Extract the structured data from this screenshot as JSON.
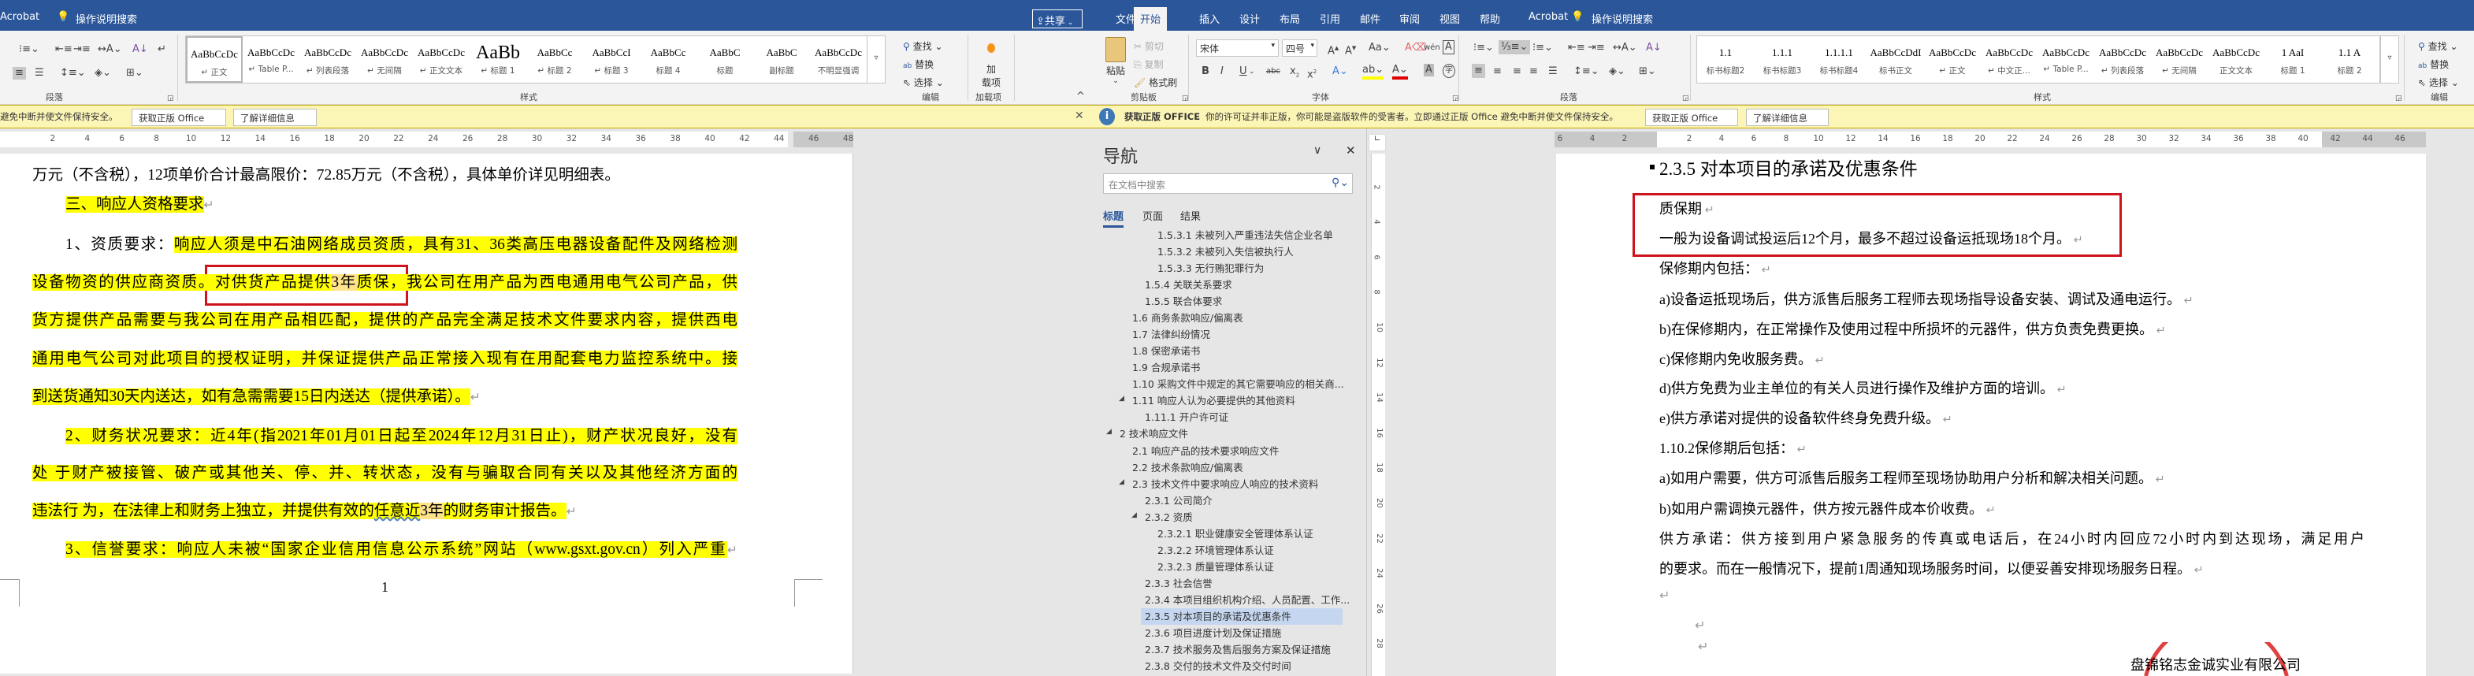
{
  "left_window": {
    "titlebar": {
      "acrobat_tab": "Acrobat",
      "search": "操作说明搜索",
      "share": "共享"
    },
    "ribbon": {
      "paragraph_label": "段落",
      "styles_label": "样式",
      "styles": [
        {
          "preview": "AaBbCcDc",
          "label": "↵ 正文",
          "selected": true
        },
        {
          "preview": "AaBbCcDc",
          "label": "↵ Table P..."
        },
        {
          "preview": "AaBbCcDc",
          "label": "↵ 列表段落"
        },
        {
          "preview": "AaBbCcDc",
          "label": "↵ 无间隔"
        },
        {
          "preview": "AaBbCcDc",
          "label": "↵ 正文文本"
        },
        {
          "preview": "AaBb",
          "label": "↵ 标题 1"
        },
        {
          "preview": "AaBbCc",
          "label": "↵ 标题 2"
        },
        {
          "preview": "AaBbCcI",
          "label": "↵ 标题 3"
        },
        {
          "preview": "AaBbCc",
          "label": "标题 4"
        },
        {
          "preview": "AaBbC",
          "label": "标题"
        },
        {
          "preview": "AaBbC",
          "label": "副标题"
        },
        {
          "preview": "AaBbCcDc",
          "label": "不明显强调"
        }
      ],
      "edit": {
        "find": "查找",
        "replace": "替换",
        "select": "选择",
        "label": "编辑"
      },
      "addins": {
        "button_line1": "加",
        "button_line2": "载项",
        "label": "加载项"
      }
    },
    "infobar": {
      "text": "避免中断并使文件保持安全。",
      "get_office": "获取正版 Office",
      "learn_more": "了解详细信息"
    },
    "ruler": [
      "2",
      "4",
      "6",
      "8",
      "10",
      "12",
      "14",
      "16",
      "18",
      "20",
      "22",
      "24",
      "26",
      "28",
      "30",
      "32",
      "34",
      "36",
      "38",
      "40",
      "42",
      "44",
      "46",
      "48"
    ],
    "document": {
      "page_number": "1",
      "lines": [
        {
          "indent": false,
          "segments": [
            {
              "text": "万元（不含税），12项单价合计最高限价：72.85万元（不含税），具体单价详见明细表。",
              "hl": ""
            }
          ]
        },
        {
          "indent": true,
          "segments": [
            {
              "text": "三、响应人资格要求",
              "hl": "hl"
            },
            {
              "text": "↵",
              "hl": "pm"
            }
          ]
        },
        {
          "indent": true,
          "justify": true,
          "segments": [
            {
              "text": "1、资质要求：",
              "hl": ""
            },
            {
              "text": "响应人须是中石油网络成员资质，具有31、36类高压电器设备配件及网络检测",
              "hl": "hl"
            }
          ]
        },
        {
          "indent": false,
          "justify": true,
          "segments": [
            {
              "text": "设备物资的供应商资质。对供货产品提供",
              "hl": "hl"
            },
            {
              "text": "3年",
              "hl": "hit"
            },
            {
              "text": "质保，我公司在用产品为西电通用电气公司产品，供",
              "hl": "hl"
            }
          ]
        },
        {
          "indent": false,
          "justify": true,
          "segments": [
            {
              "text": "货方提供产品需要与我公司在用产品相匹配，提供的产品完全满足技术文件要求内容，提供西电",
              "hl": "hl"
            }
          ]
        },
        {
          "indent": false,
          "justify": true,
          "segments": [
            {
              "text": "通用电气公司对此项目的授权证明，并保证提供产品正常接入现有在用配套电力监控系统中。接",
              "hl": "hl"
            }
          ]
        },
        {
          "indent": false,
          "segments": [
            {
              "text": "到送货通知30天内送达，如有急需需要15日内送达（提供承诺）。",
              "hl": "hl"
            },
            {
              "text": "↵",
              "hl": "pm"
            }
          ]
        },
        {
          "indent": true,
          "justify": true,
          "segments": [
            {
              "text": "2、财务状况要求：近4年(指2021年01月01日起至2024年12月31日止)，财产状况良好，没有",
              "hl": "hl"
            }
          ]
        },
        {
          "indent": false,
          "justify": true,
          "segments": [
            {
              "text": "处    于财产被接管、破产或其他关、停、并、转状态，没有与骗取合同有关以及其他经济方面的",
              "hl": "hl"
            }
          ]
        },
        {
          "indent": false,
          "segments": [
            {
              "text": "违法行    为，在法律上和财务上独立，并提供有效的",
              "hl": "hl"
            },
            {
              "text": "任意近",
              "hl": "hl wavy"
            },
            {
              "text": "3年",
              "hl": "hit"
            },
            {
              "text": "的财务审计报告。",
              "hl": "hl"
            },
            {
              "text": "↵",
              "hl": "pm"
            }
          ]
        },
        {
          "indent": true,
          "justify": true,
          "segments": [
            {
              "text": "3、信誉要求：响应人未被“国家企业信用信息公示系统”网站（www.gsxt.gov.cn）列入严重",
              "hl": "hl"
            },
            {
              "text": "↵",
              "hl": "pm"
            }
          ]
        }
      ]
    }
  },
  "right_window": {
    "tabs": [
      "文件",
      "开始",
      "插入",
      "设计",
      "布局",
      "引用",
      "邮件",
      "审阅",
      "视图",
      "帮助",
      "Acrobat"
    ],
    "active_tab": "开始",
    "search": "操作说明搜索",
    "ribbon": {
      "clipboard": {
        "paste": "粘贴",
        "cut": "剪切",
        "copy": "复制",
        "format_painter": "格式刷",
        "label": "剪贴板"
      },
      "font": {
        "name": "宋体",
        "size": "四号",
        "label": "字体"
      },
      "paragraph_label": "段落",
      "styles_label": "样式",
      "styles": [
        {
          "preview": "1.1",
          "label": "标书标题2"
        },
        {
          "preview": "1.1.1",
          "label": "标书标题3"
        },
        {
          "preview": "1.1.1.1",
          "label": "标书标题4"
        },
        {
          "preview": "AaBbCcDdI",
          "label": "标书正文"
        },
        {
          "preview": "AaBbCcDc",
          "label": "↵ 正文"
        },
        {
          "preview": "AaBbCcDc",
          "label": "↵ 中文正..."
        },
        {
          "preview": "AaBbCcDc",
          "label": "↵ Table P..."
        },
        {
          "preview": "AaBbCcDc",
          "label": "↵ 列表段落"
        },
        {
          "preview": "AaBbCcDc",
          "label": "↵ 无间隔"
        },
        {
          "preview": "AaBbCcDc",
          "label": "正文文本"
        },
        {
          "preview": "1  AaI",
          "label": "标题 1"
        },
        {
          "preview": "1.1  A",
          "label": "标题 2"
        }
      ],
      "edit": {
        "find": "查找",
        "replace": "替换",
        "select": "选择",
        "label": "编辑"
      }
    },
    "infobar": {
      "title": "获取正版 OFFICE",
      "text": "你的许可证并非正版，你可能是盗版软件的受害者。立即通过正版 Office 避免中断并使文件保持安全。",
      "get_office": "获取正版 Office",
      "learn_more": "了解详细信息"
    },
    "navigation": {
      "title": "导航",
      "search_placeholder": "在文档中搜索",
      "tabs": [
        "标题",
        "页面",
        "结果"
      ],
      "active_tab": "标题",
      "items": [
        {
          "text": "1.5.3.1 未被列入严重违法失信企业名单",
          "level": 4
        },
        {
          "text": "1.5.3.2 未被列入失信被执行人",
          "level": 4
        },
        {
          "text": "1.5.3.3 无行贿犯罪行为",
          "level": 4
        },
        {
          "text": "1.5.4 关联关系要求",
          "level": 3
        },
        {
          "text": "1.5.5 联合体要求",
          "level": 3
        },
        {
          "text": "1.6 商务条款响应/偏离表",
          "level": 2
        },
        {
          "text": "1.7 法律纠纷情况",
          "level": 2
        },
        {
          "text": "1.8 保密承诺书",
          "level": 2
        },
        {
          "text": "1.9 合规承诺书",
          "level": 2
        },
        {
          "text": "1.10 采购文件中规定的其它需要响应的相关商...",
          "level": 2
        },
        {
          "text": "1.11 响应人认为必要提供的其他资料",
          "level": 2,
          "expanded": true
        },
        {
          "text": "1.11.1 开户许可证",
          "level": 3
        },
        {
          "text": "2 技术响应文件",
          "level": 1,
          "expanded": true
        },
        {
          "text": "2.1 响应产品的技术要求响应文件",
          "level": 2
        },
        {
          "text": "2.2 技术条款响应/偏离表",
          "level": 2
        },
        {
          "text": "2.3 技术文件中要求响应人响应的技术资料",
          "level": 2,
          "expanded": true
        },
        {
          "text": "2.3.1 公司简介",
          "level": 3
        },
        {
          "text": "2.3.2 资质",
          "level": 3,
          "expanded": true
        },
        {
          "text": "2.3.2.1 职业健康安全管理体系认证",
          "level": 4
        },
        {
          "text": "2.3.2.2 环境管理体系认证",
          "level": 4
        },
        {
          "text": "2.3.2.3 质量管理体系认证",
          "level": 4
        },
        {
          "text": "2.3.3 社会信誉",
          "level": 3
        },
        {
          "text": "2.3.4 本项目组织机构介绍、人员配置、工作...",
          "level": 3
        },
        {
          "text": "2.3.5 对本项目的承诺及优惠条件",
          "level": 3,
          "selected": true
        },
        {
          "text": "2.3.6 项目进度计划及保证措施",
          "level": 3
        },
        {
          "text": "2.3.7 技术服务及售后服务方案及保证措施",
          "level": 3
        },
        {
          "text": "2.3.8 交付的技术文件及交付时间",
          "level": 3
        }
      ]
    },
    "ruler": {
      "negative": [
        "6",
        "4",
        "2"
      ],
      "positive": [
        "2",
        "4",
        "6",
        "8",
        "10",
        "12",
        "14",
        "16",
        "18",
        "20",
        "22",
        "24",
        "26",
        "28",
        "30",
        "32",
        "34",
        "36",
        "38",
        "40",
        "42",
        "44",
        "46"
      ],
      "vertical": [
        "2",
        "4",
        "6",
        "8",
        "10",
        "12",
        "14",
        "16",
        "18",
        "20",
        "22",
        "24",
        "26",
        "28"
      ]
    },
    "document": {
      "heading": "2.3.5 对本项目的承诺及优惠条件",
      "lines": [
        "质保期",
        "一般为设备调试投运后12个月，最多不超过设备运抵现场18个月。",
        "保修期内包括：",
        "a)设备运抵现场后，供方派售后服务工程师去现场指导设备安装、调试及通电运行。",
        "b)在保修期内，在正常操作及使用过程中所损坏的元器件，供方负责免费更换。",
        "c)保修期内免收服务费。",
        "d)供方免费为业主单位的有关人员进行操作及维护方面的培训。",
        "e)供方承诺对提供的设备软件终身免费升级。",
        "1.10.2保修期后包括：",
        "a)如用户需要，供方可派售后服务工程师至现场协助用户分析和解决相关问题。",
        "b)如用户需调换元器件，供方按元器件成本价收费。",
        "供方承诺：供方接到用户紧急服务的传真或电话后，在24小时内回应72小时内到达现场，满足用户",
        "的要求。而在一般情况下，提前1周通知现场服务时间，以便妥善安排现场服务日程。"
      ],
      "company": "盘锦铭志金诚实业有限公司"
    }
  },
  "colors": {
    "title_blue": "#2b579a",
    "highlight": "#ffff00",
    "annotation_red": "#d0121b",
    "infobar": "#fcf6b6"
  }
}
